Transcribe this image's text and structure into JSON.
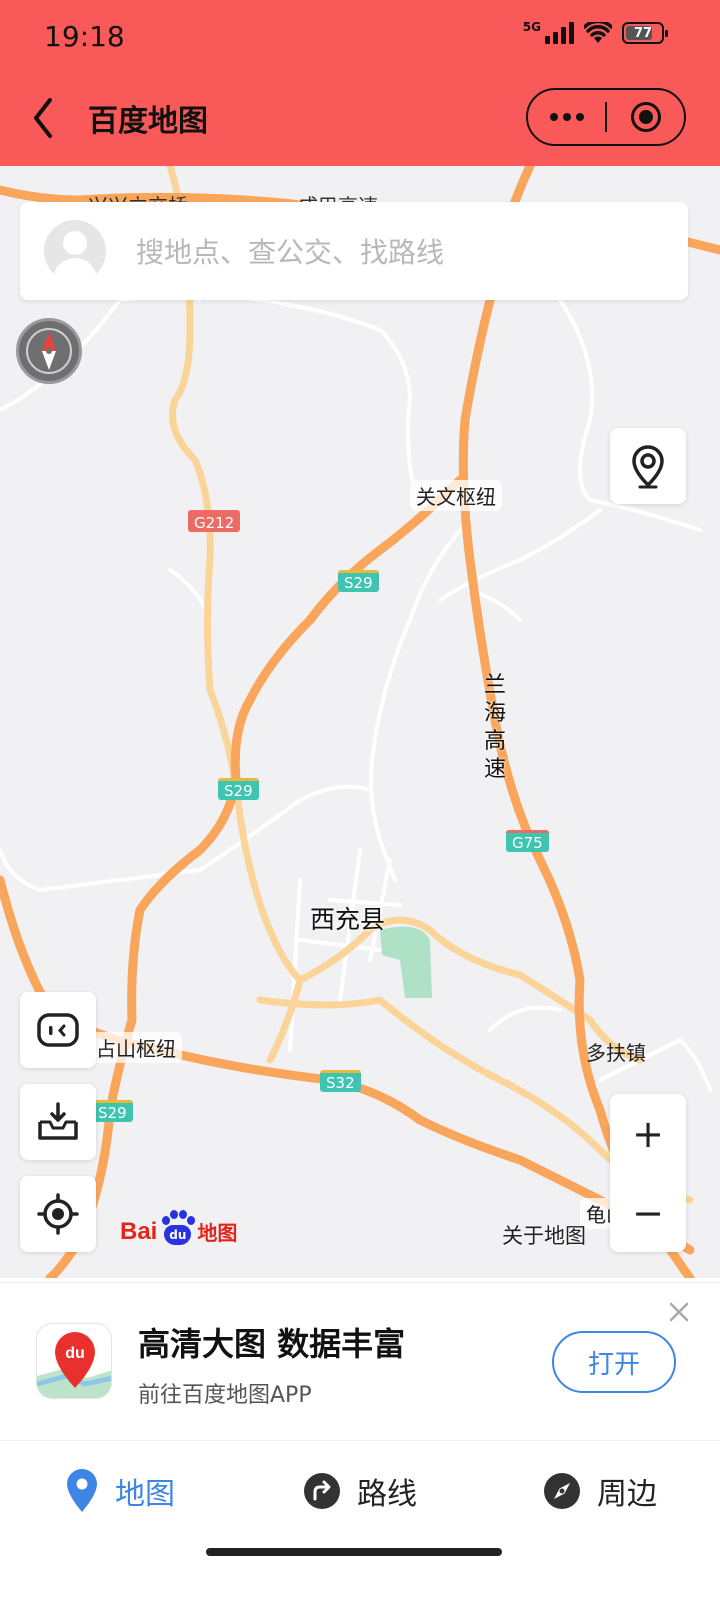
{
  "status_bar": {
    "time": "19:18",
    "network": "5G",
    "battery": "77",
    "battery_level": 0.77
  },
  "nav": {
    "back_icon": "chevron-left-icon",
    "title": "百度地图",
    "more_icon": "more-dots-icon",
    "close_icon": "target-circle-icon"
  },
  "search": {
    "placeholder": "搜地点、查公交、找路线",
    "avatar_icon": "user-avatar-icon"
  },
  "map": {
    "top_partial_labels": [
      "兴兴立交桥",
      "成巴高速"
    ],
    "road_tags": [
      "G212",
      "S29",
      "S29",
      "G75",
      "S29",
      "S32"
    ],
    "labels": {
      "guanwen": "关文枢纽",
      "lanhai": "兰海高速",
      "xichong": "西充县",
      "zhanshan": "占山枢纽",
      "duofu": "多扶镇",
      "gui": "龟山"
    },
    "about": "关于地图",
    "logo": {
      "bai": "Bai",
      "du": "du",
      "map": "地图"
    },
    "controls": {
      "compass_icon": "compass-icon",
      "location_pin_icon": "location-pin-icon",
      "robot_icon": "robot-assistant-icon",
      "download_icon": "offline-download-icon",
      "locate_icon": "locate-crosshair-icon",
      "zoom_in": "+",
      "zoom_out": "−"
    },
    "colors": {
      "highway": "#F9A65C",
      "provincial": "#FBD49A",
      "background": "#F1F1F4"
    }
  },
  "promo": {
    "title": "高清大图 数据丰富",
    "subtitle": "前往百度地图APP",
    "open_button": "打开",
    "close_icon": "close-icon"
  },
  "tabs": [
    {
      "label": "地图",
      "icon": "map-pin-icon",
      "active": true
    },
    {
      "label": "路线",
      "icon": "route-icon",
      "active": false
    },
    {
      "label": "周边",
      "icon": "compass-nearby-icon",
      "active": false
    }
  ],
  "colors": {
    "topbar": "#F95A59",
    "accent": "#3D86E6"
  }
}
